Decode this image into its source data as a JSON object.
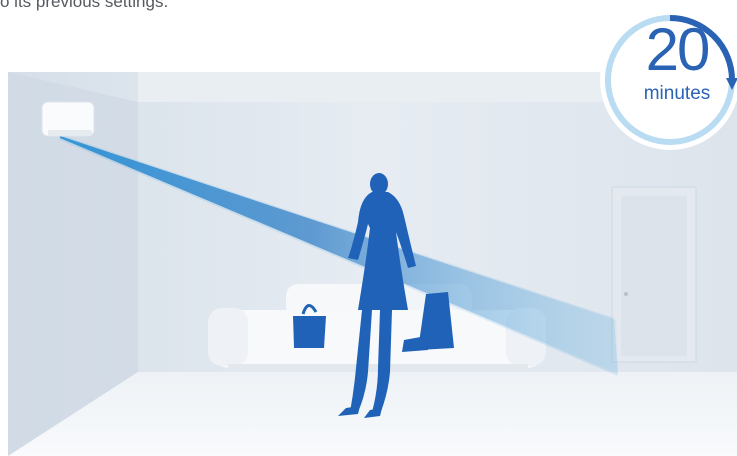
{
  "caption": "o its previous settings.",
  "timer": {
    "number": "20",
    "unit": "minutes",
    "progress": 0.25
  },
  "colors": {
    "accent": "#2a62b4",
    "airflow": "#3a9ad8",
    "wall": "#dfe6ee"
  },
  "icons": [
    "air-conditioner-icon",
    "person-silhouette",
    "handbag-icon",
    "shopping-bag-icon",
    "sofa",
    "door"
  ]
}
